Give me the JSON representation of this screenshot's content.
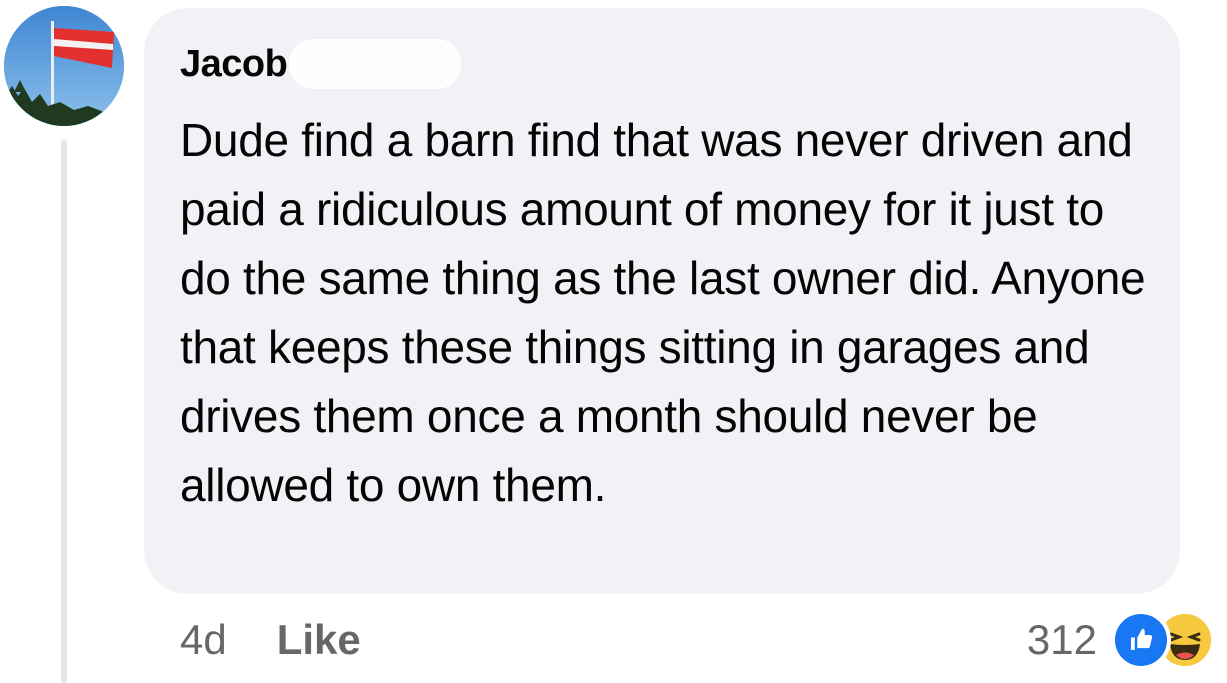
{
  "comment": {
    "author": "Jacob",
    "text": "Dude find a barn find that was never driven and paid a ridiculous amount of money for it just to do the same thing as the last owner did. Anyone that keeps these things sitting in garages and drives them once a month should never be allowed to own them."
  },
  "footer": {
    "time": "4d",
    "like_label": "Like"
  },
  "reactions": {
    "count": "312",
    "icons": [
      "like-icon",
      "haha-icon"
    ],
    "like_color": "#1877f2",
    "haha_color": "#f7c93e"
  },
  "colors": {
    "bubble": "#f0f2f5",
    "text": "#050505",
    "muted": "#65676b"
  }
}
